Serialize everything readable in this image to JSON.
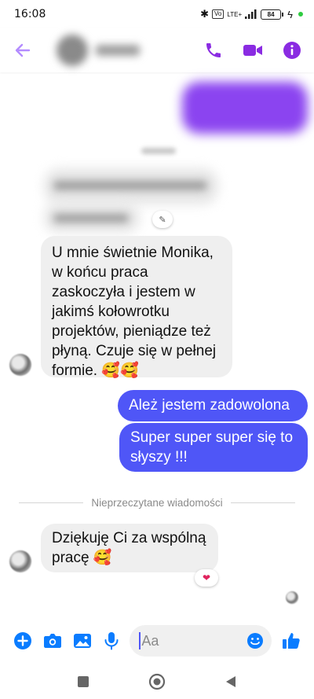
{
  "status_bar": {
    "time": "16:08",
    "network": "LTE+",
    "battery": "84"
  },
  "header": {
    "accent_color": "#8a2be2"
  },
  "messages": {
    "incoming_long": "U mnie świetnie Monika,\nw końcu praca\nzaskoczyła i jestem w\njakimś kołowrotku\nprojektów, pieniądze też\npłyną. Czuje się w pełnej\nformie. 🥰🥰",
    "outgoing_1": "Ależ jestem zadowolona",
    "outgoing_2": "Super super super się to\nsłyszy !!!",
    "divider": "Nieprzeczytane wiadomości",
    "incoming_last": "Dziękuję Ci za wspólną\npracę 🥰",
    "reaction": "❤"
  },
  "composer": {
    "placeholder": "Aa"
  },
  "colors": {
    "outgoing_bubble": "#4f56f7",
    "incoming_bubble": "#efefef",
    "composer_icons": "#0a7cff",
    "header_icons": "#8a2be2"
  }
}
